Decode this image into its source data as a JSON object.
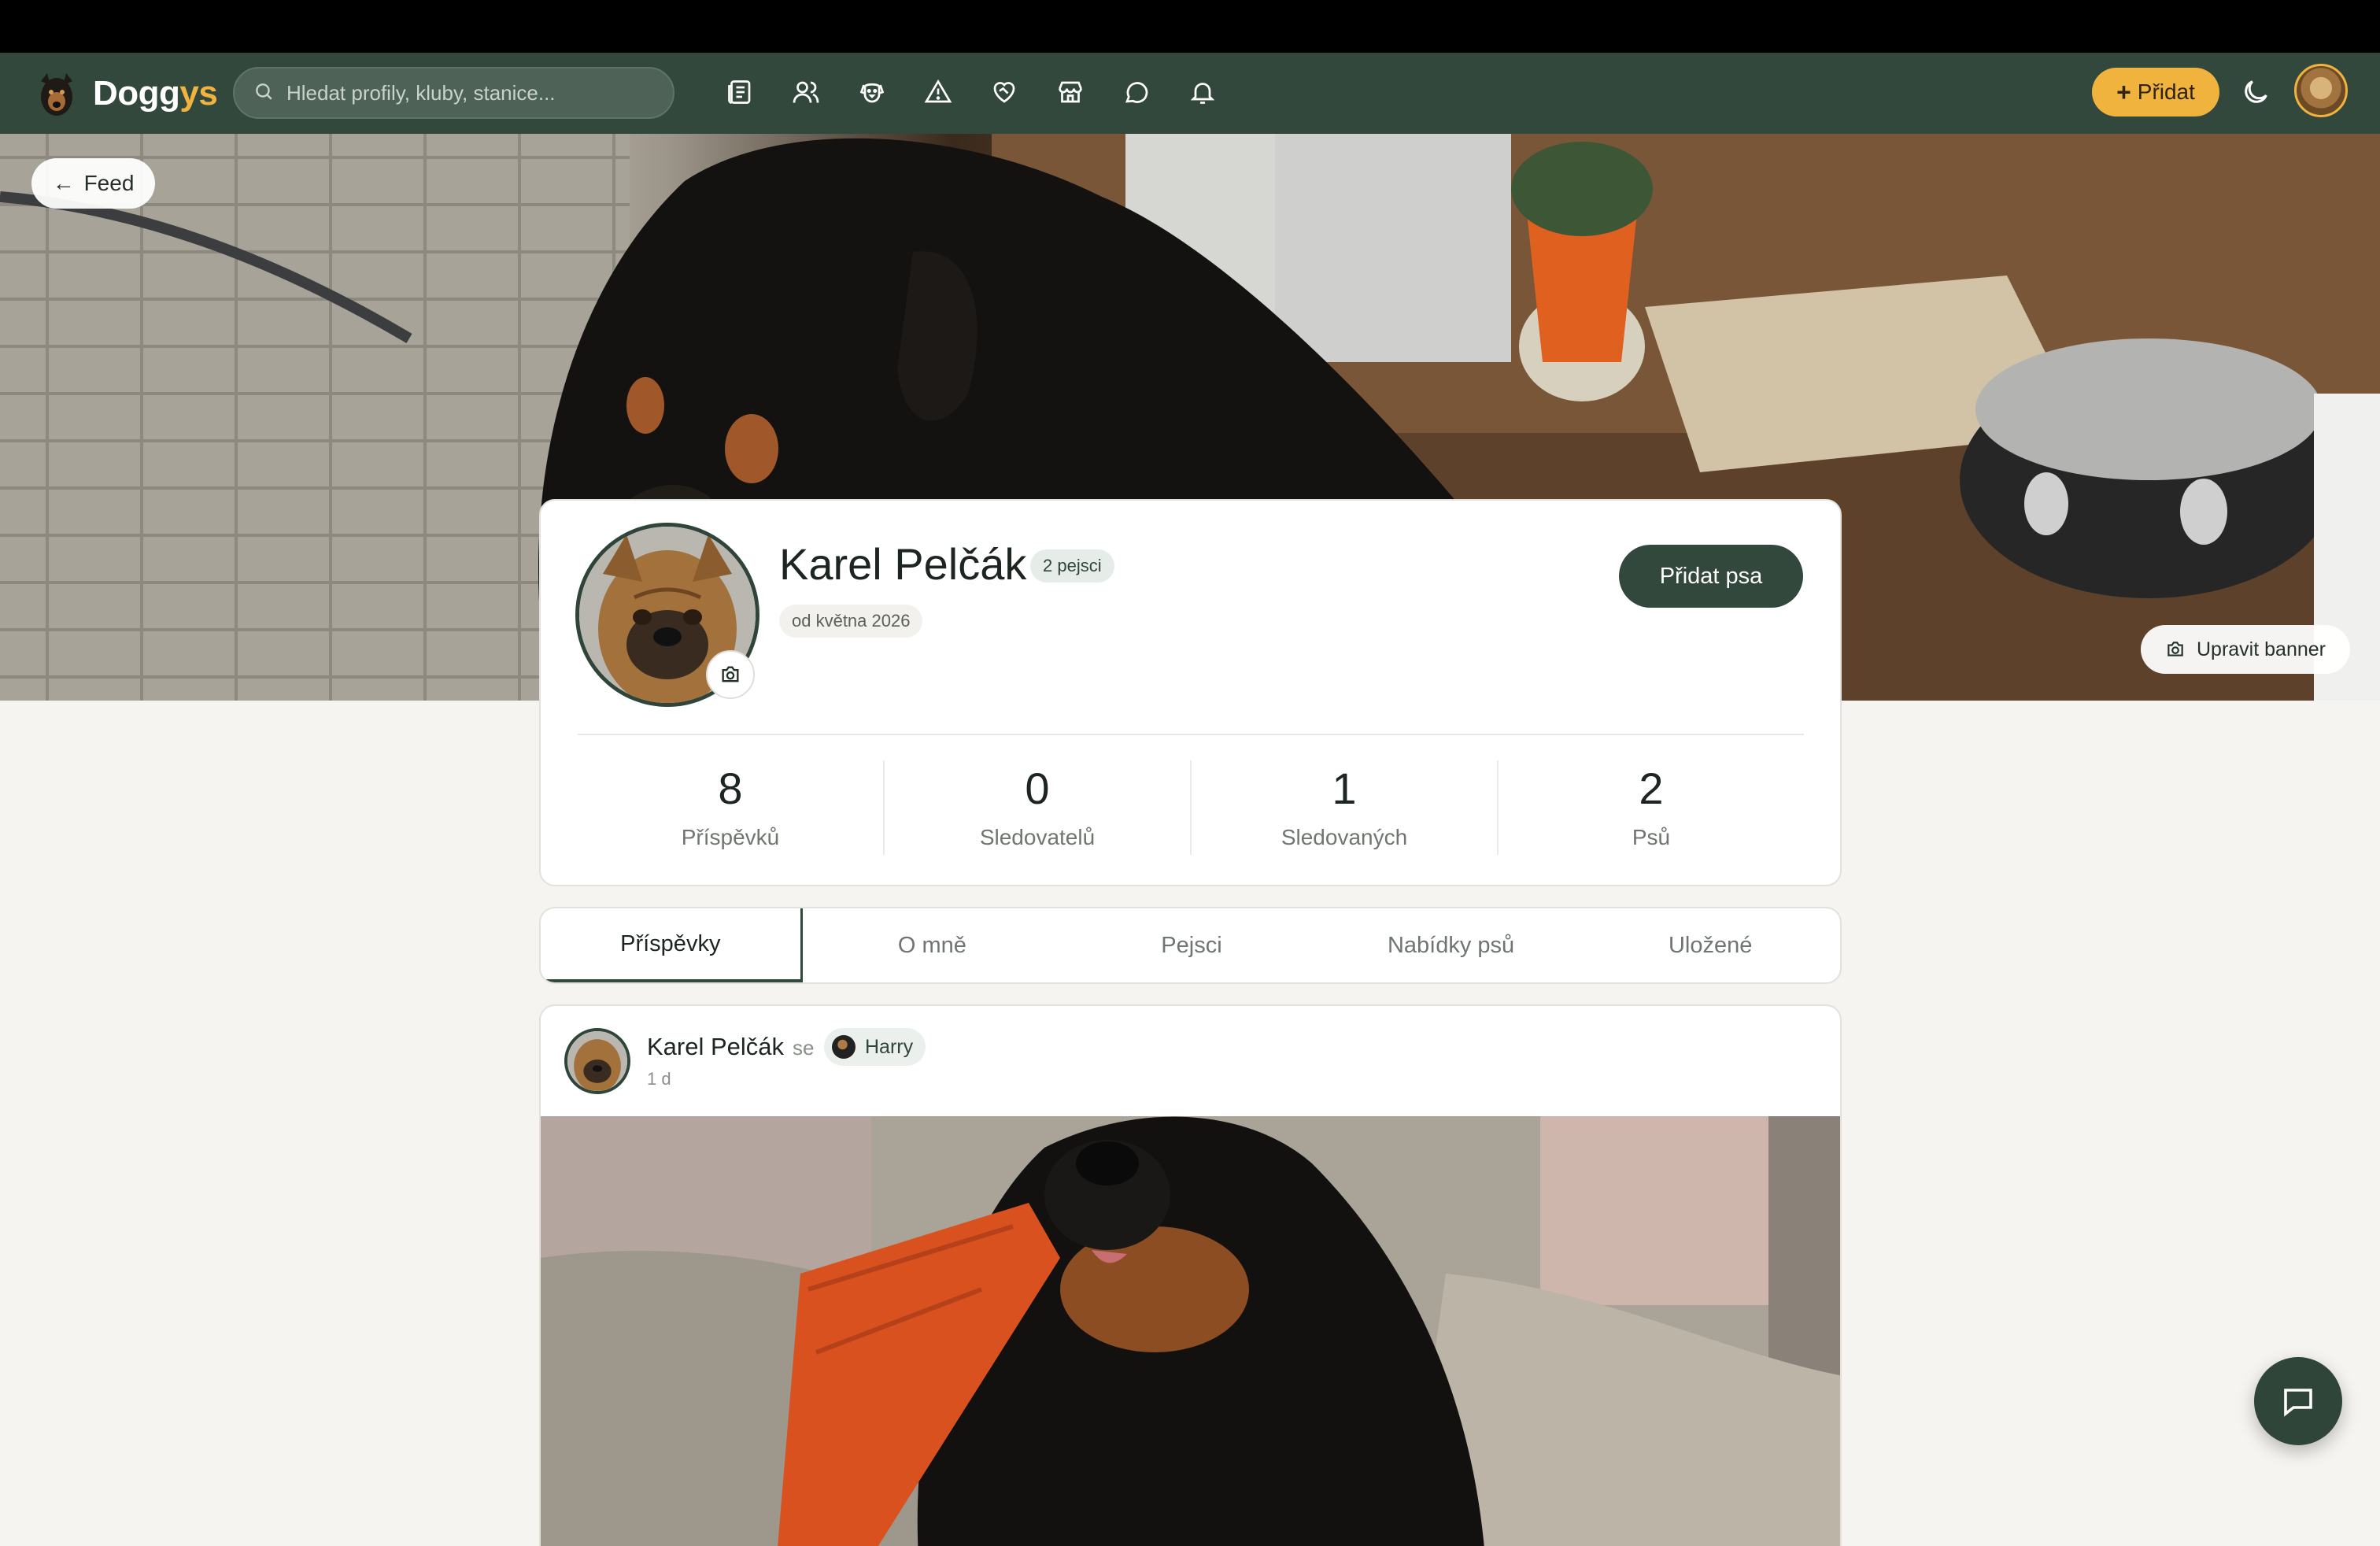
{
  "app": {
    "logo_prefix": "Dogg",
    "logo_accent": "ys",
    "brand_color": "#33483d",
    "accent_color": "#f0b33e"
  },
  "nav": {
    "search_placeholder": "Hledat profily, kluby, stanice...",
    "icons": [
      "feed-icon",
      "people-icon",
      "dog-icon",
      "warning-icon",
      "heart-handshake-icon",
      "store-icon",
      "chat-icon",
      "bell-icon"
    ],
    "add_label": "Přidat",
    "theme_icon": "moon-icon"
  },
  "banner": {
    "back_label": "Feed",
    "edit_label": "Upravit banner"
  },
  "profile": {
    "name": "Karel Pelčák",
    "dogs_badge": "2 pejsci",
    "since": "od května 2026",
    "add_dog_label": "Přidat psa",
    "stats": [
      {
        "value": "8",
        "label": "Příspěvků"
      },
      {
        "value": "0",
        "label": "Sledovatelů"
      },
      {
        "value": "1",
        "label": "Sledovaných"
      },
      {
        "value": "2",
        "label": "Psů"
      }
    ]
  },
  "tabs": [
    {
      "label": "Příspěvky",
      "active": true
    },
    {
      "label": "O mně",
      "active": false
    },
    {
      "label": "Pejsci",
      "active": false
    },
    {
      "label": "Nabídky psů",
      "active": false
    },
    {
      "label": "Uložené",
      "active": false
    }
  ],
  "post": {
    "author": "Karel Pelčák",
    "with_word": "se",
    "dog_name": "Harry",
    "time": "1 d"
  }
}
